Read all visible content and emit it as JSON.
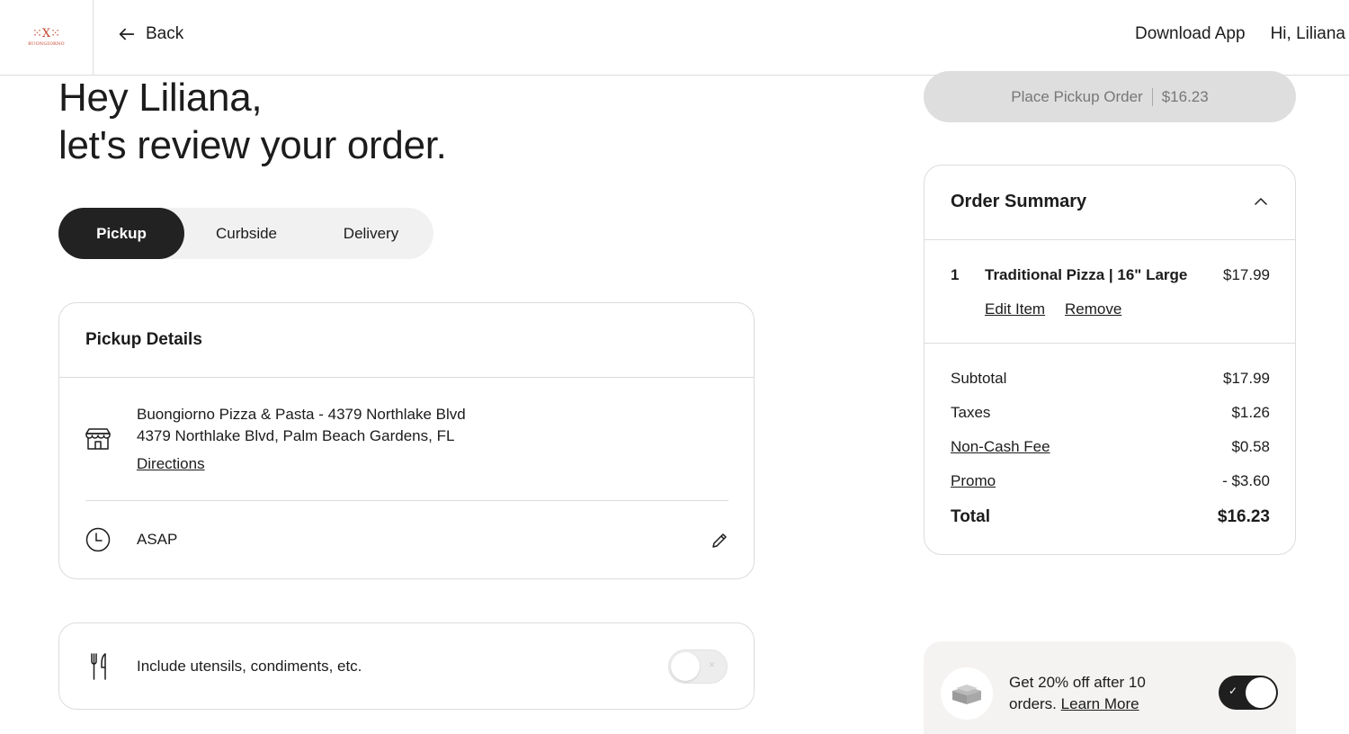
{
  "header": {
    "logo_mark": "⁙X⁙",
    "logo_text": "BUONGIORNO",
    "back_label": "Back",
    "download_label": "Download App",
    "greeting": "Hi, Liliana"
  },
  "heading": {
    "line1": "Hey Liliana,",
    "line2": "let's review your order."
  },
  "tabs": [
    {
      "label": "Pickup",
      "active": true
    },
    {
      "label": "Curbside",
      "active": false
    },
    {
      "label": "Delivery",
      "active": false
    }
  ],
  "pickup": {
    "title": "Pickup Details",
    "store_name": "Buongiorno Pizza & Pasta - 4379 Northlake Blvd",
    "store_address": "4379 Northlake Blvd, Palm Beach Gardens, FL",
    "directions_label": "Directions",
    "time_label": "ASAP"
  },
  "utensils": {
    "label": "Include utensils, condiments, etc.",
    "enabled": false,
    "toggle_glyph": "×"
  },
  "place_order": {
    "label": "Place Pickup Order",
    "amount": "$16.23"
  },
  "summary": {
    "title": "Order Summary",
    "items": [
      {
        "qty": "1",
        "name": "Traditional Pizza | 16\" Large",
        "price": "$17.99",
        "edit_label": "Edit Item",
        "remove_label": "Remove"
      }
    ],
    "rows": [
      {
        "label": "Subtotal",
        "value": "$17.99"
      },
      {
        "label": "Taxes",
        "value": "$1.26"
      },
      {
        "label": "Non-Cash Fee",
        "value": "$0.58"
      },
      {
        "label": "Promo",
        "value": "- $3.60"
      },
      {
        "label": "Total",
        "value": "$16.23"
      }
    ]
  },
  "promo": {
    "text": "Get 20% off after 10 orders.",
    "text_line1": "Get 20% off after 10",
    "text_line2": "orders.",
    "link_label": "Learn More",
    "enabled": true,
    "toggle_glyph": "✓"
  },
  "colors": {
    "dark": "#222222",
    "accent": "#c4412b",
    "border": "#dcdcdc",
    "disabled_button": "#dedede"
  }
}
